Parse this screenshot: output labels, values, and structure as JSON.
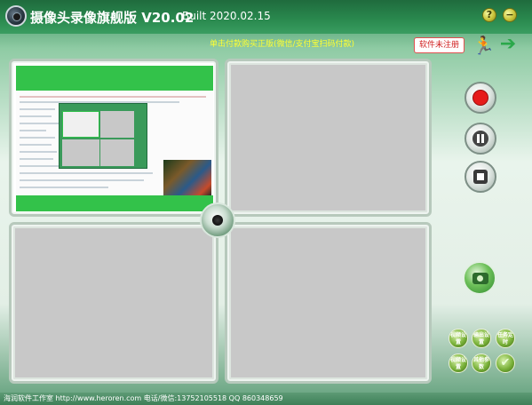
{
  "titlebar": {
    "title": "摄像头录像旗舰版  V20.02",
    "build": "Built  2020.02.15",
    "help_label": "?",
    "minimize_label": "−"
  },
  "banner": {
    "purchase_text": "单击付款购买正版(微信/支付宝扫码付款)",
    "unregistered_badge": "软件未注册"
  },
  "icons": {
    "runner": "exit-runner-icon",
    "arrow": "forward-arrow-icon"
  },
  "controls": {
    "record": "record-button",
    "pause": "pause-button",
    "stop": "stop-button",
    "snapshot": "snapshot-button"
  },
  "settings_buttons": [
    {
      "label": "视频设置"
    },
    {
      "label": "输出设置"
    },
    {
      "label": "任务定时"
    },
    {
      "label": "视频设置"
    },
    {
      "label": "其他参数"
    },
    {
      "label": "✔"
    }
  ],
  "footer": {
    "text": "海润软件工作室  http://www.heroren.com  电话/微信:13752105518  QQ 860348659"
  },
  "colors": {
    "brand_green": "#2a8a4f",
    "record_red": "#e61a1a",
    "unregistered_red": "#d02020"
  }
}
